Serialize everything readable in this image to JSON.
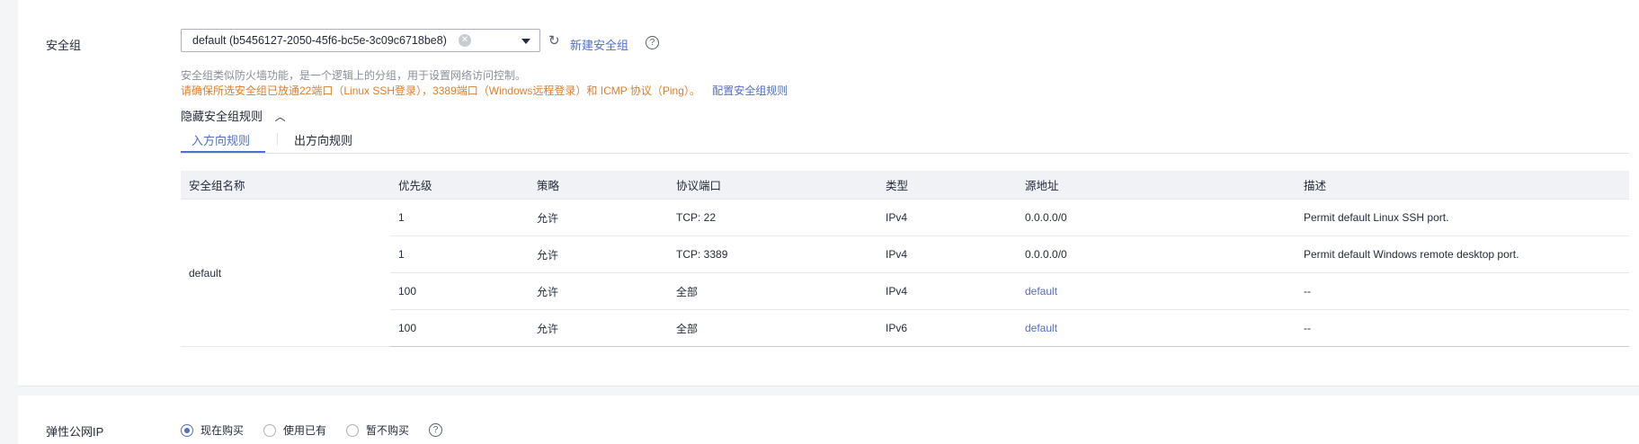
{
  "security_group": {
    "label": "安全组",
    "selected": "default (b5456127-2050-45f6-bc5e-3c09c6718be8)",
    "new_link": "新建安全组",
    "hint_line1": "安全组类似防火墙功能，是一个逻辑上的分组，用于设置网络访问控制。",
    "hint_line2": "请确保所选安全组已放通22端口（Linux SSH登录），3389端口（Windows远程登录）和 ICMP 协议（Ping）。",
    "config_link": "配置安全组规则",
    "toggle_label": "隐藏安全组规则",
    "tabs": [
      "入方向规则",
      "出方向规则"
    ],
    "table": {
      "headers": [
        "安全组名称",
        "优先级",
        "策略",
        "协议端口",
        "类型",
        "源地址",
        "描述"
      ],
      "group_name": "default",
      "rows": [
        {
          "priority": "1",
          "policy": "允许",
          "port": "TCP: 22",
          "type": "IPv4",
          "source": "0.0.0.0/0",
          "desc": "Permit default Linux SSH port."
        },
        {
          "priority": "1",
          "policy": "允许",
          "port": "TCP: 3389",
          "type": "IPv4",
          "source": "0.0.0.0/0",
          "desc": "Permit default Windows remote desktop port."
        },
        {
          "priority": "100",
          "policy": "允许",
          "port": "全部",
          "type": "IPv4",
          "source": "default",
          "desc": "--"
        },
        {
          "priority": "100",
          "policy": "允许",
          "port": "全部",
          "type": "IPv6",
          "source": "default",
          "desc": "--"
        }
      ]
    }
  },
  "eip": {
    "label": "弹性公网IP",
    "options": [
      "现在购买",
      "使用已有",
      "暂不购买"
    ],
    "selected": "现在购买"
  },
  "colors": {
    "accent": "#526ecc",
    "warning": "#e27d2a"
  }
}
